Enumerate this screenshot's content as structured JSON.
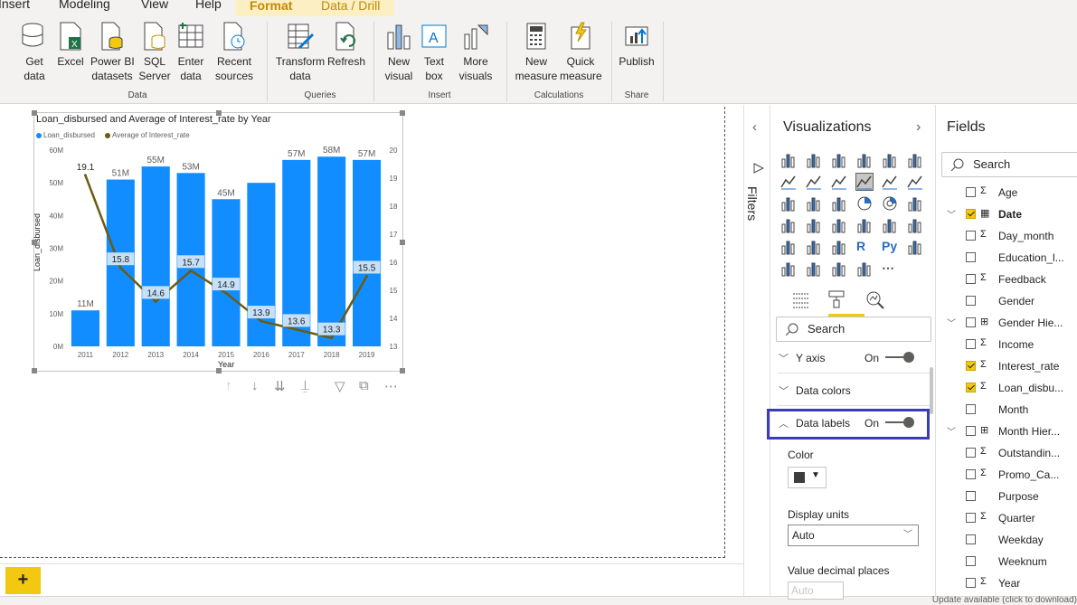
{
  "ribbon": {
    "tabs": [
      {
        "label": "Insert"
      },
      {
        "label": "Modeling"
      },
      {
        "label": "View"
      },
      {
        "label": "Help"
      },
      {
        "label": "Format"
      },
      {
        "label": "Data / Drill"
      }
    ],
    "buttons": {
      "get_data": "Get\ndata",
      "excel": "Excel",
      "pbi_datasets": "Power BI\ndatasets",
      "sql_server": "SQL\nServer",
      "enter_data": "Enter\ndata",
      "recent_sources": "Recent\nsources",
      "transform_data": "Transform\ndata",
      "refresh": "Refresh",
      "new_visual": "New\nvisual",
      "text_box": "Text\nbox",
      "more_visuals": "More\nvisuals",
      "new_measure": "New\nmeasure",
      "quick_measure": "Quick\nmeasure",
      "publish": "Publish"
    },
    "groups": {
      "data": "Data",
      "queries": "Queries",
      "insert": "Insert",
      "calculations": "Calculations",
      "share": "Share"
    }
  },
  "visual": {
    "toolbar_icons": [
      "arrow-up-icon",
      "arrow-down-icon",
      "double-arrow-down-icon",
      "expand-hierarchy-icon",
      "filter-icon",
      "focus-mode-icon",
      "more-options-icon"
    ]
  },
  "chart_data": {
    "type": "bar",
    "title": "Loan_disbursed and Average of Interest_rate by Year",
    "xlabel": "Year",
    "ylabel": "Loan_disbursed",
    "categories": [
      "2011",
      "2012",
      "2013",
      "2014",
      "2015",
      "2016",
      "2017",
      "2018",
      "2019"
    ],
    "ylim": [
      0,
      60
    ],
    "y_ticks": [
      "0M",
      "10M",
      "20M",
      "30M",
      "40M",
      "50M",
      "60M"
    ],
    "y2lim": [
      13,
      20
    ],
    "y2_ticks": [
      "13",
      "14",
      "15",
      "16",
      "17",
      "18",
      "19",
      "20"
    ],
    "legend_position": "top-left",
    "series": [
      {
        "name": "Loan_disbursed",
        "type": "bar",
        "color": "#118dff",
        "values": [
          11,
          51,
          55,
          53,
          45,
          50,
          57,
          58,
          57
        ],
        "labels": [
          "11M",
          "51M",
          "55M",
          "53M",
          "45M",
          "",
          "57M",
          "58M",
          "57M"
        ]
      },
      {
        "name": "Average of Interest_rate",
        "type": "line",
        "axis": "secondary",
        "color": "#6b5c12",
        "values": [
          19.1,
          15.8,
          14.6,
          15.7,
          14.9,
          13.9,
          13.6,
          13.3,
          15.5
        ],
        "labels": [
          "19.1",
          "15.8",
          "14.6",
          "15.7",
          "14.9",
          "13.9",
          "13.6",
          "13.3",
          "15.5"
        ]
      }
    ]
  },
  "filters": {
    "label": "Filters"
  },
  "visualizations": {
    "title": "Visualizations",
    "search_placeholder": "Search",
    "sections": {
      "y_axis": {
        "label": "Y axis",
        "state": "On"
      },
      "data_colors": {
        "label": "Data colors"
      },
      "data_labels": {
        "label": "Data labels",
        "state": "On"
      }
    },
    "color_label": "Color",
    "color_value": "#3d3d3d",
    "display_units_label": "Display units",
    "display_units_value": "Auto",
    "decimal_places_label": "Value decimal places",
    "decimal_places_value": "Auto"
  },
  "fields": {
    "title": "Fields",
    "search_placeholder": "Search",
    "items": [
      {
        "name": "Age",
        "icon": "sigma",
        "checked": false,
        "expandable": false
      },
      {
        "name": "Date",
        "icon": "calendar",
        "checked": true,
        "expandable": true,
        "bold": true
      },
      {
        "name": "Day_month",
        "icon": "sigma",
        "checked": false,
        "expandable": false
      },
      {
        "name": "Education_l...",
        "icon": "",
        "checked": false,
        "expandable": false
      },
      {
        "name": "Feedback",
        "icon": "sigma",
        "checked": false,
        "expandable": false
      },
      {
        "name": "Gender",
        "icon": "",
        "checked": false,
        "expandable": false
      },
      {
        "name": "Gender Hie...",
        "icon": "hierarchy",
        "checked": false,
        "expandable": true
      },
      {
        "name": "Income",
        "icon": "sigma",
        "checked": false,
        "expandable": false
      },
      {
        "name": "Interest_rate",
        "icon": "sigma",
        "checked": true,
        "expandable": false
      },
      {
        "name": "Loan_disbu...",
        "icon": "sigma",
        "checked": true,
        "expandable": false
      },
      {
        "name": "Month",
        "icon": "",
        "checked": false,
        "expandable": false
      },
      {
        "name": "Month Hier...",
        "icon": "hierarchy",
        "checked": false,
        "expandable": true
      },
      {
        "name": "Outstandin...",
        "icon": "sigma",
        "checked": false,
        "expandable": false
      },
      {
        "name": "Promo_Ca...",
        "icon": "sigma",
        "checked": false,
        "expandable": false
      },
      {
        "name": "Purpose",
        "icon": "",
        "checked": false,
        "expandable": false
      },
      {
        "name": "Quarter",
        "icon": "sigma",
        "checked": false,
        "expandable": false
      },
      {
        "name": "Weekday",
        "icon": "",
        "checked": false,
        "expandable": false
      },
      {
        "name": "Weeknum",
        "icon": "",
        "checked": false,
        "expandable": false
      },
      {
        "name": "Year",
        "icon": "sigma",
        "checked": false,
        "expandable": false
      }
    ]
  },
  "status": {
    "text": "Update available (click to download)"
  },
  "pages": {
    "add_label": "+"
  }
}
